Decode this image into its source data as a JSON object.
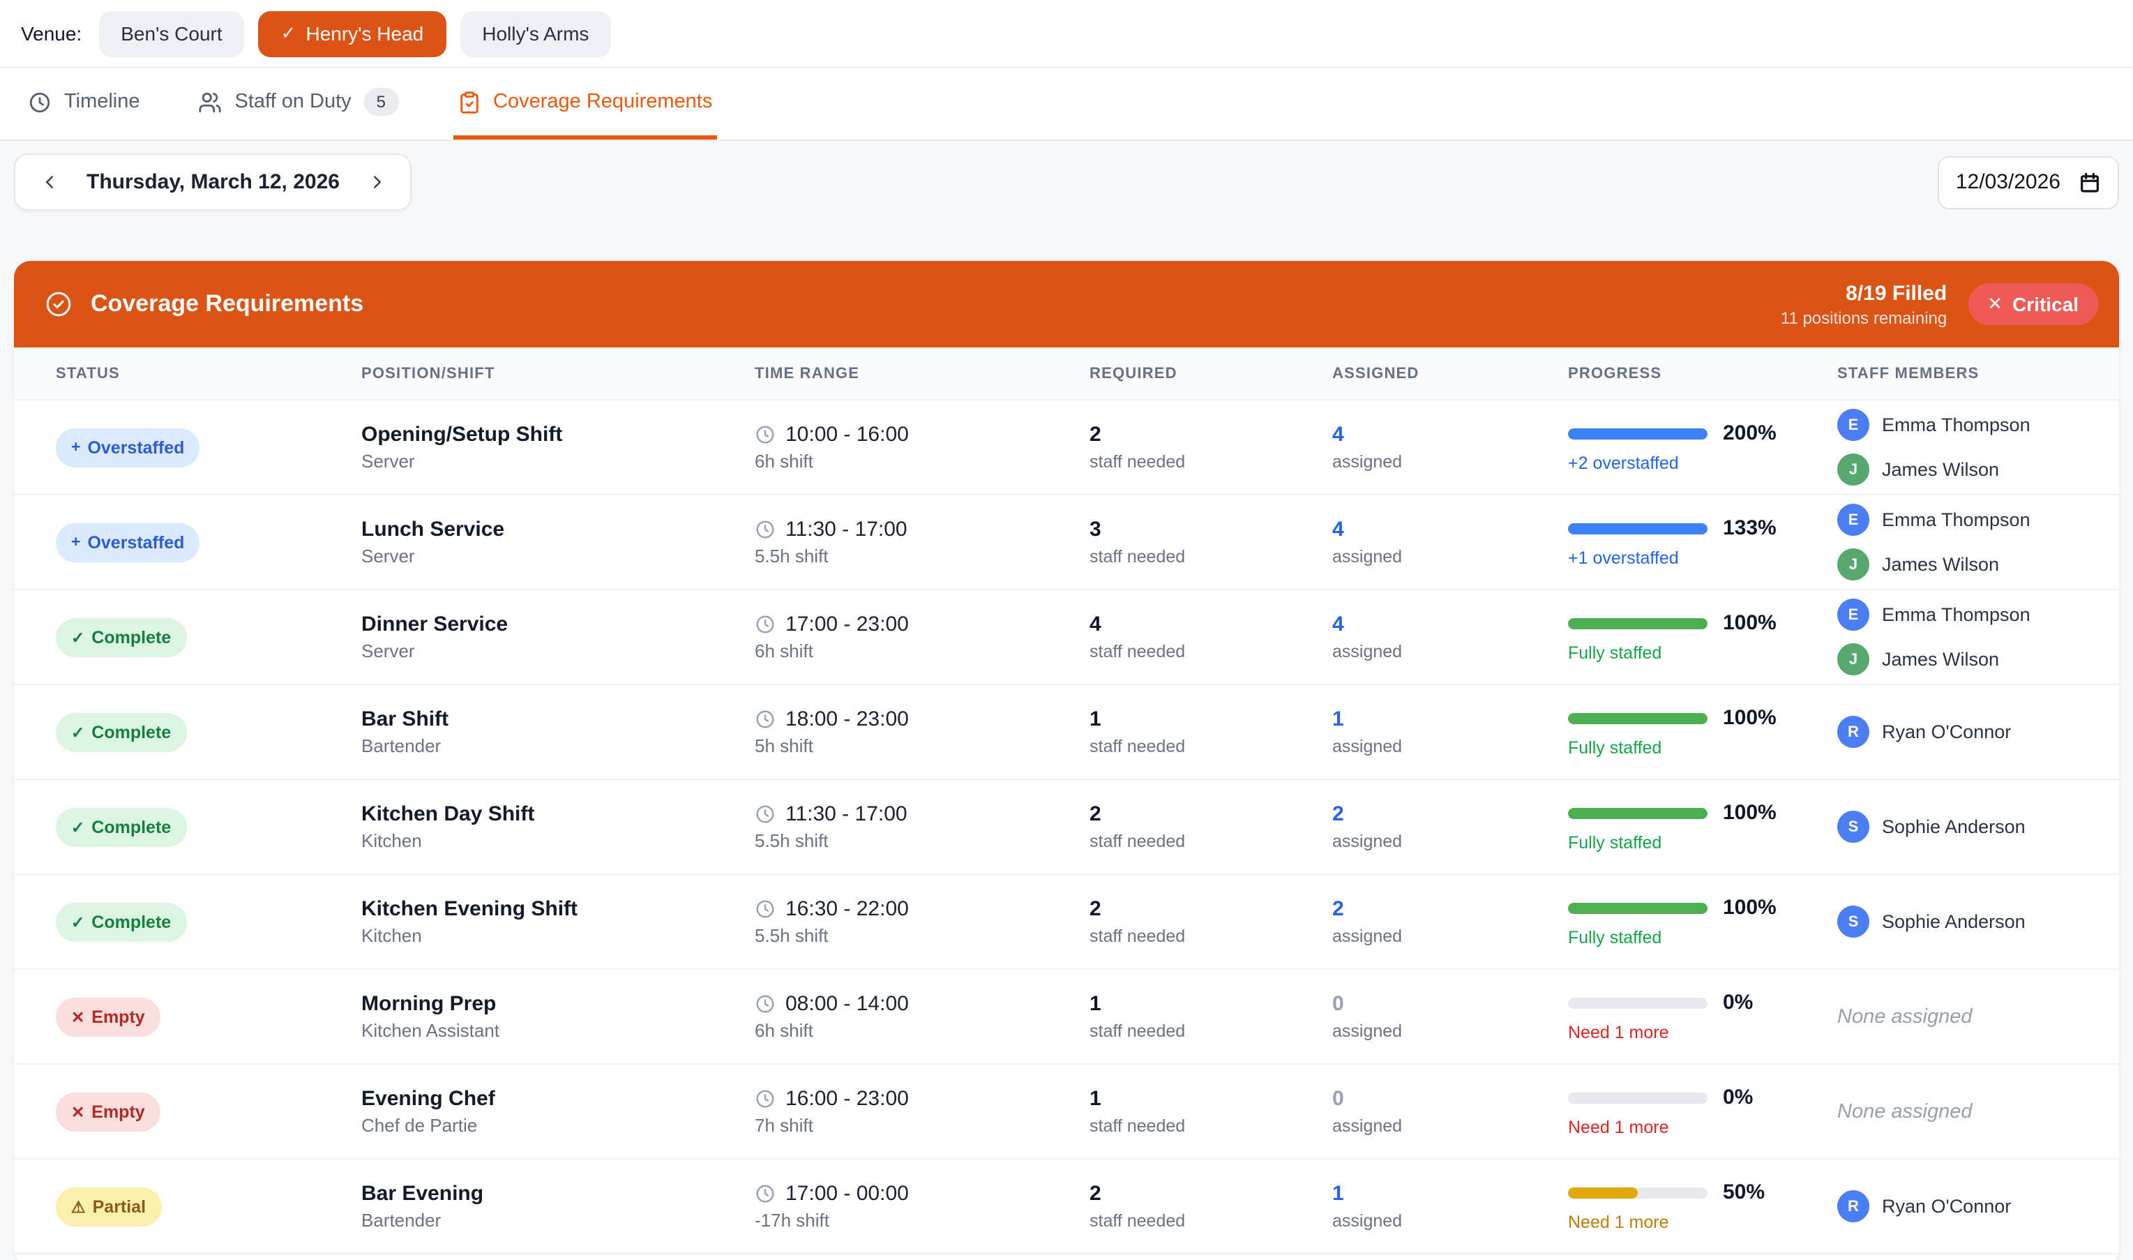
{
  "venue_bar": {
    "label": "Venue:",
    "venues": [
      {
        "name": "Ben's Court",
        "selected": false
      },
      {
        "name": "Henry's Head",
        "selected": true
      },
      {
        "name": "Holly's Arms",
        "selected": false
      }
    ]
  },
  "tabs": [
    {
      "label": "Timeline",
      "icon": "clock-icon",
      "active": false
    },
    {
      "label": "Staff on Duty",
      "icon": "users-icon",
      "badge": "5",
      "active": false
    },
    {
      "label": "Coverage Requirements",
      "icon": "clipboard-check-icon",
      "active": true
    }
  ],
  "date_nav": {
    "label": "Thursday, March 12, 2026"
  },
  "date_input": {
    "value": "12/03/2026"
  },
  "summary": {
    "title": "Coverage Requirements",
    "filled": "8/19 Filled",
    "remaining": "11 positions remaining",
    "critical_label": "Critical"
  },
  "icons": {
    "check": "✓",
    "cross": "✕",
    "plus": "+",
    "warning": "⚠"
  },
  "colors": {
    "accent_orange": "#dc5415",
    "tab_orange": "#ea580c",
    "critical_red": "#ef5a57",
    "progress_blue": "#3b82f6",
    "progress_green": "#4cb052",
    "progress_yellow": "#e0a90e",
    "avatar_blue": "#4c7ef3",
    "avatar_green": "#57a86e"
  },
  "table": {
    "columns": [
      "STATUS",
      "POSITION/SHIFT",
      "TIME RANGE",
      "REQUIRED",
      "ASSIGNED",
      "PROGRESS",
      "STAFF MEMBERS"
    ],
    "none_assigned_label": "None assigned",
    "rows": [
      {
        "status": {
          "type": "overstaffed",
          "icon": "+",
          "label": "Overstaffed"
        },
        "position": "Opening/Setup Shift",
        "role": "Server",
        "time": "10:00 - 16:00",
        "duration": "6h shift",
        "required": "2",
        "required_label": "staff needed",
        "assigned": "4",
        "assigned_style": "link",
        "assigned_label": "assigned",
        "progress": "200%",
        "bar_pct": 100,
        "bar_color": "blue",
        "note": "+2 overstaffed",
        "note_color": "blue",
        "staff": [
          {
            "initial": "E",
            "name": "Emma Thompson",
            "color": "blue"
          },
          {
            "initial": "J",
            "name": "James Wilson",
            "color": "green"
          }
        ]
      },
      {
        "status": {
          "type": "overstaffed",
          "icon": "+",
          "label": "Overstaffed"
        },
        "position": "Lunch Service",
        "role": "Server",
        "time": "11:30 - 17:00",
        "duration": "5.5h shift",
        "required": "3",
        "required_label": "staff needed",
        "assigned": "4",
        "assigned_style": "link",
        "assigned_label": "assigned",
        "progress": "133%",
        "bar_pct": 100,
        "bar_color": "blue",
        "note": "+1 overstaffed",
        "note_color": "blue",
        "staff": [
          {
            "initial": "E",
            "name": "Emma Thompson",
            "color": "blue"
          },
          {
            "initial": "J",
            "name": "James Wilson",
            "color": "green"
          }
        ]
      },
      {
        "status": {
          "type": "complete",
          "icon": "✓",
          "label": "Complete"
        },
        "position": "Dinner Service",
        "role": "Server",
        "time": "17:00 - 23:00",
        "duration": "6h shift",
        "required": "4",
        "required_label": "staff needed",
        "assigned": "4",
        "assigned_style": "link",
        "assigned_label": "assigned",
        "progress": "100%",
        "bar_pct": 100,
        "bar_color": "green",
        "note": "Fully staffed",
        "note_color": "green",
        "staff": [
          {
            "initial": "E",
            "name": "Emma Thompson",
            "color": "blue"
          },
          {
            "initial": "J",
            "name": "James Wilson",
            "color": "green"
          }
        ]
      },
      {
        "status": {
          "type": "complete",
          "icon": "✓",
          "label": "Complete"
        },
        "position": "Bar Shift",
        "role": "Bartender",
        "time": "18:00 - 23:00",
        "duration": "5h shift",
        "required": "1",
        "required_label": "staff needed",
        "assigned": "1",
        "assigned_style": "link",
        "assigned_label": "assigned",
        "progress": "100%",
        "bar_pct": 100,
        "bar_color": "green",
        "note": "Fully staffed",
        "note_color": "green",
        "staff": [
          {
            "initial": "R",
            "name": "Ryan O'Connor",
            "color": "blue"
          }
        ]
      },
      {
        "status": {
          "type": "complete",
          "icon": "✓",
          "label": "Complete"
        },
        "position": "Kitchen Day Shift",
        "role": "Kitchen",
        "time": "11:30 - 17:00",
        "duration": "5.5h shift",
        "required": "2",
        "required_label": "staff needed",
        "assigned": "2",
        "assigned_style": "link",
        "assigned_label": "assigned",
        "progress": "100%",
        "bar_pct": 100,
        "bar_color": "green",
        "note": "Fully staffed",
        "note_color": "green",
        "staff": [
          {
            "initial": "S",
            "name": "Sophie Anderson",
            "color": "blue"
          }
        ]
      },
      {
        "status": {
          "type": "complete",
          "icon": "✓",
          "label": "Complete"
        },
        "position": "Kitchen Evening Shift",
        "role": "Kitchen",
        "time": "16:30 - 22:00",
        "duration": "5.5h shift",
        "required": "2",
        "required_label": "staff needed",
        "assigned": "2",
        "assigned_style": "link",
        "assigned_label": "assigned",
        "progress": "100%",
        "bar_pct": 100,
        "bar_color": "green",
        "note": "Fully staffed",
        "note_color": "green",
        "staff": [
          {
            "initial": "S",
            "name": "Sophie Anderson",
            "color": "blue"
          }
        ]
      },
      {
        "status": {
          "type": "empty",
          "icon": "✕",
          "label": "Empty"
        },
        "position": "Morning Prep",
        "role": "Kitchen Assistant",
        "time": "08:00 - 14:00",
        "duration": "6h shift",
        "required": "1",
        "required_label": "staff needed",
        "assigned": "0",
        "assigned_style": "muted",
        "assigned_label": "assigned",
        "progress": "0%",
        "bar_pct": 0,
        "bar_color": "none",
        "note": "Need 1 more",
        "note_color": "red",
        "staff": []
      },
      {
        "status": {
          "type": "empty",
          "icon": "✕",
          "label": "Empty"
        },
        "position": "Evening Chef",
        "role": "Chef de Partie",
        "time": "16:00 - 23:00",
        "duration": "7h shift",
        "required": "1",
        "required_label": "staff needed",
        "assigned": "0",
        "assigned_style": "muted",
        "assigned_label": "assigned",
        "progress": "0%",
        "bar_pct": 0,
        "bar_color": "none",
        "note": "Need 1 more",
        "note_color": "red",
        "staff": []
      },
      {
        "status": {
          "type": "partial",
          "icon": "⚠",
          "label": "Partial"
        },
        "position": "Bar Evening",
        "role": "Bartender",
        "time": "17:00 - 00:00",
        "duration": "-17h shift",
        "required": "2",
        "required_label": "staff needed",
        "assigned": "1",
        "assigned_style": "link",
        "assigned_label": "assigned",
        "progress": "50%",
        "bar_pct": 50,
        "bar_color": "yellow",
        "note": "Need 1 more",
        "note_color": "amber",
        "staff": [
          {
            "initial": "R",
            "name": "Ryan O'Connor",
            "color": "blue"
          }
        ]
      }
    ]
  }
}
